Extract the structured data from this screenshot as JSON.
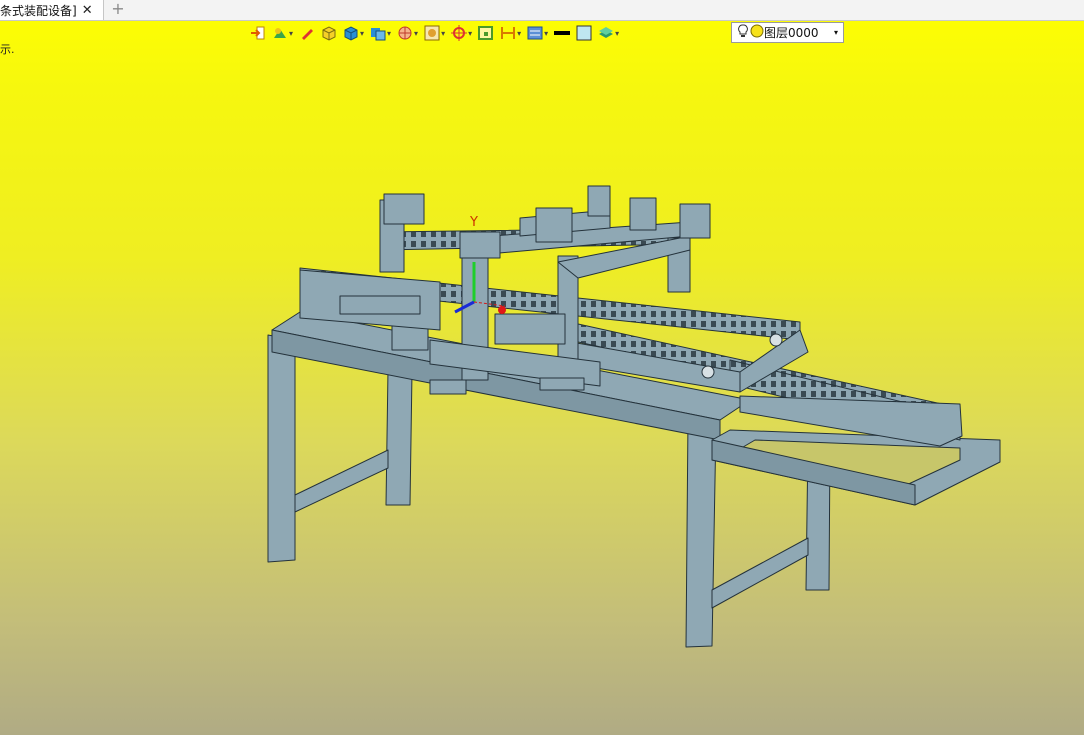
{
  "tab": {
    "title": "条式装配设备]",
    "close": "✕",
    "add": "+"
  },
  "hint_text": "示.",
  "toolbar": {
    "items": [
      {
        "name": "import-icon",
        "has_dropdown": false
      },
      {
        "name": "shade-icon",
        "has_dropdown": true
      },
      {
        "name": "pen-icon",
        "has_dropdown": false
      },
      {
        "name": "solid-box-icon",
        "has_dropdown": false
      },
      {
        "name": "cube-icon",
        "has_dropdown": true
      },
      {
        "name": "view-cube-icon",
        "has_dropdown": true
      },
      {
        "name": "sphere-grid-icon",
        "has_dropdown": true
      },
      {
        "name": "render-icon",
        "has_dropdown": true
      },
      {
        "name": "snap-target-icon",
        "has_dropdown": true
      },
      {
        "name": "select-box-icon",
        "has_dropdown": false
      },
      {
        "name": "dimension-icon",
        "has_dropdown": true
      },
      {
        "name": "filter-icon",
        "has_dropdown": true
      },
      {
        "name": "line-color-icon",
        "has_dropdown": false
      },
      {
        "name": "fill-color-icon",
        "has_dropdown": false
      },
      {
        "name": "layers-icon",
        "has_dropdown": true
      }
    ],
    "dropdown_glyph": "▾"
  },
  "layer": {
    "label": "图层0000",
    "arrow": "▾"
  },
  "viewport": {
    "axis_label": "Y",
    "model_color": "#8fa8b4",
    "edge_color": "#24323b"
  }
}
